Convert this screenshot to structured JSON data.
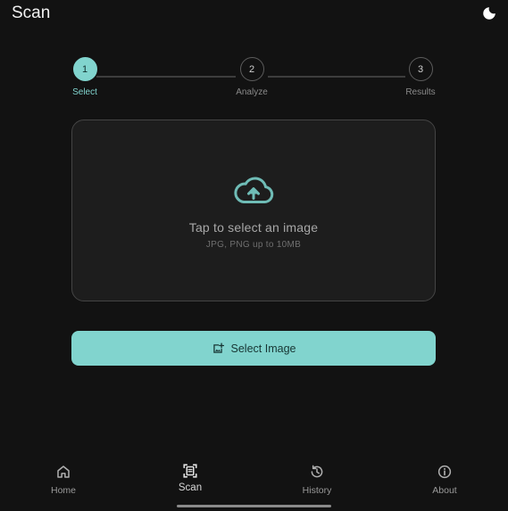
{
  "header": {
    "title": "Scan",
    "theme_toggle_icon": "moon-icon"
  },
  "stepper": {
    "current_step": 1,
    "steps": [
      {
        "number": "1",
        "label": "Select"
      },
      {
        "number": "2",
        "label": "Analyze"
      },
      {
        "number": "3",
        "label": "Results"
      }
    ]
  },
  "upload": {
    "icon": "cloud-upload-icon",
    "title": "Tap to select an image",
    "subtitle": "JPG, PNG up to 10MB"
  },
  "select_button": {
    "icon": "add-photo-icon",
    "label": "Select Image"
  },
  "nav": {
    "items": [
      {
        "label": "Home",
        "icon": "home-icon",
        "active": false
      },
      {
        "label": "Scan",
        "icon": "document-scanner-icon",
        "active": true
      },
      {
        "label": "History",
        "icon": "history-icon",
        "active": false
      },
      {
        "label": "About",
        "icon": "info-icon",
        "active": false
      }
    ]
  },
  "colors": {
    "background": "#121212",
    "surface": "#1d1d1d",
    "accent": "#81d4ce",
    "text_primary": "#f2f2f2",
    "text_secondary": "#9a9a9a"
  }
}
